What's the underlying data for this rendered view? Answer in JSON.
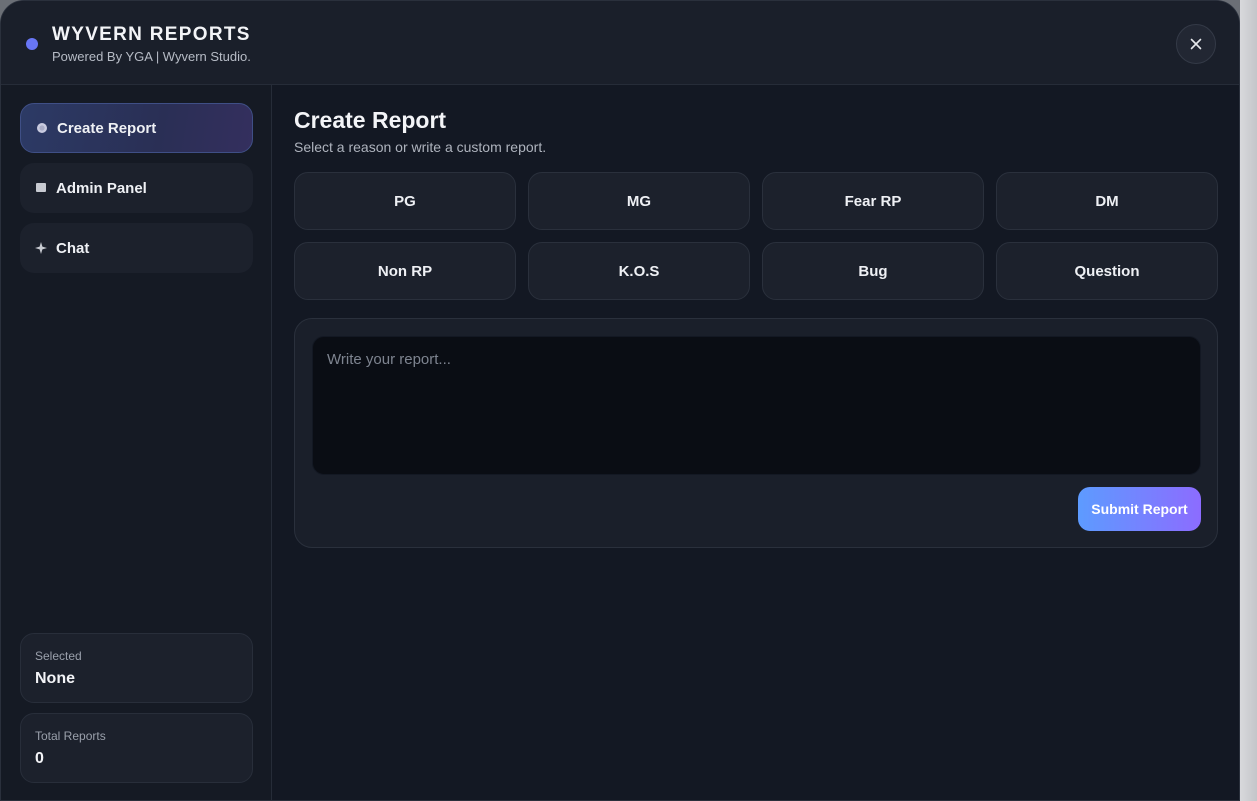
{
  "header": {
    "title": "WYVERN REPORTS",
    "subtitle": "Powered By YGA | Wyvern Studio.",
    "close_icon": "close-icon",
    "accent": "#6876f5"
  },
  "sidebar": {
    "items": [
      {
        "label": "Create Report",
        "icon": "circle-dot-icon",
        "active": true
      },
      {
        "label": "Admin Panel",
        "icon": "square-icon",
        "active": false
      },
      {
        "label": "Chat",
        "icon": "sparkle-icon",
        "active": false
      }
    ],
    "stats": {
      "selected_label": "Selected",
      "selected_value": "None",
      "total_label": "Total Reports",
      "total_value": "0"
    }
  },
  "main": {
    "title": "Create Report",
    "subtitle": "Select a reason or write a custom report.",
    "reasons": [
      "PG",
      "MG",
      "Fear RP",
      "DM",
      "Non RP",
      "K.O.S",
      "Bug",
      "Question"
    ],
    "report_placeholder": "Write your report...",
    "submit_label": "Submit Report",
    "submit_gradient": [
      "#5d9bff",
      "#8c6cff"
    ]
  }
}
